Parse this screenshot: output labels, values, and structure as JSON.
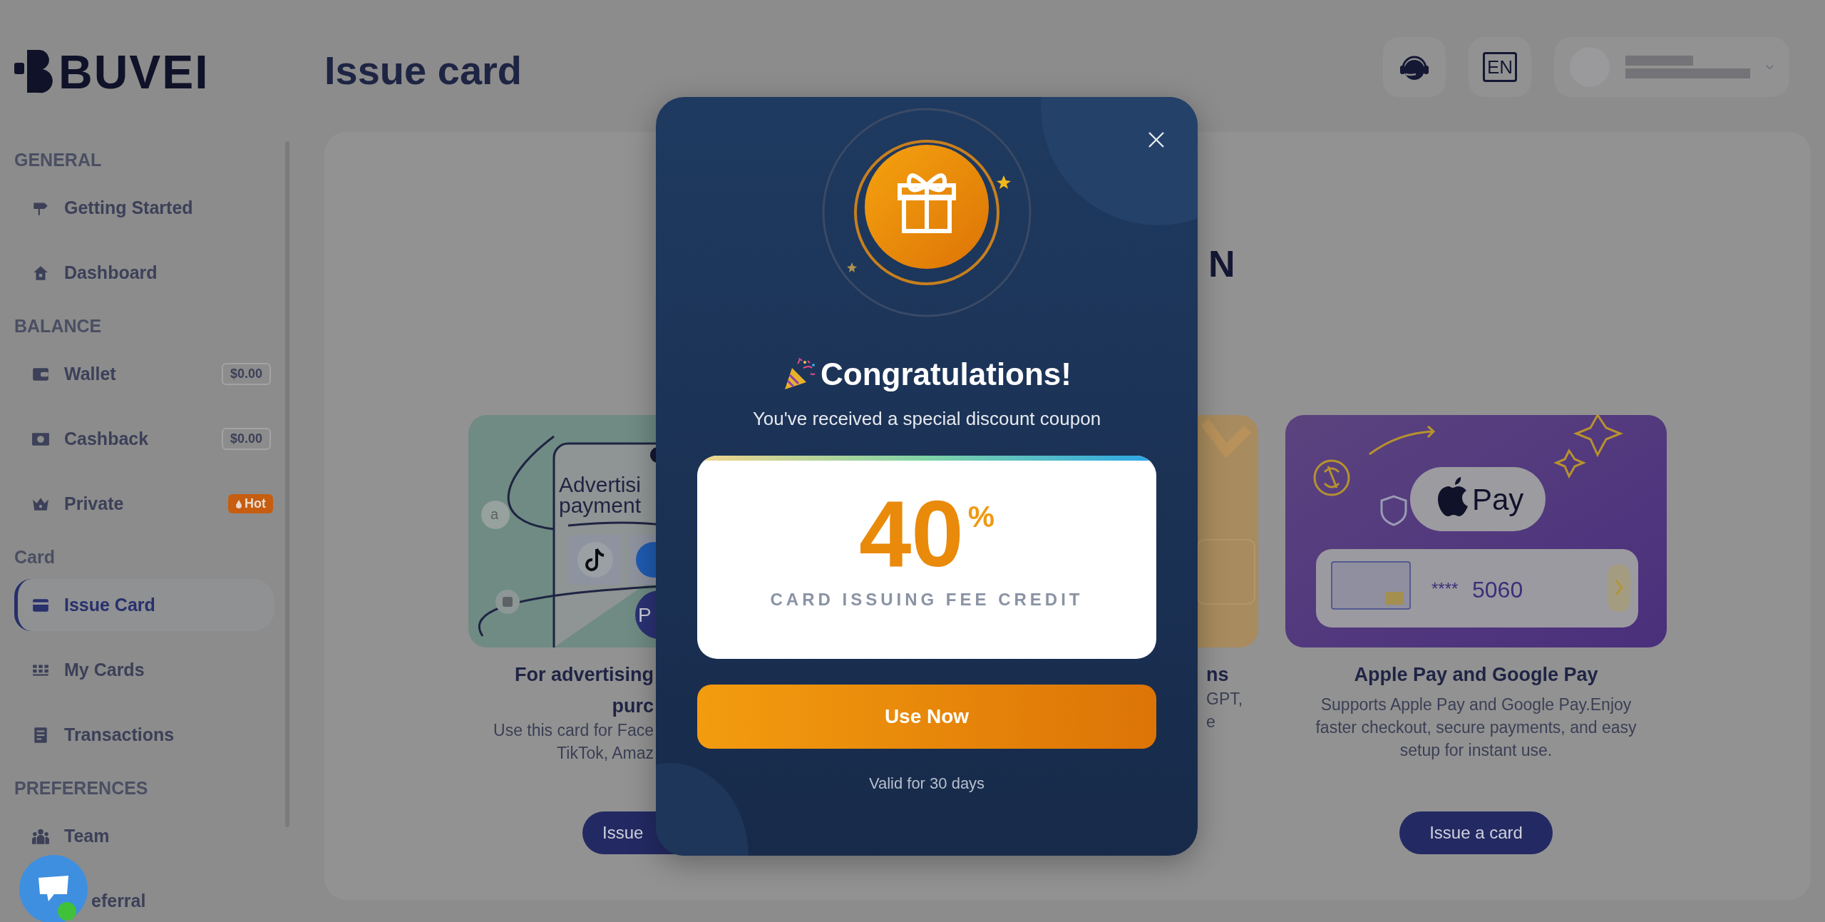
{
  "logo": {
    "text": "BUVEI"
  },
  "sidebar": {
    "sections": [
      {
        "title": "GENERAL",
        "items": [
          {
            "label": "Getting Started",
            "selected": false
          },
          {
            "label": "Dashboard",
            "selected": false
          }
        ]
      },
      {
        "title": "BALANCE",
        "items": [
          {
            "label": "Wallet",
            "selected": false,
            "badge": {
              "kind": "amount",
              "text": "$0.00"
            }
          },
          {
            "label": "Cashback",
            "selected": false,
            "badge": {
              "kind": "amount",
              "text": "$0.00"
            }
          },
          {
            "label": "Private",
            "selected": false,
            "badge": {
              "kind": "hot",
              "text": "Hot"
            }
          }
        ]
      },
      {
        "title": "Card",
        "items": [
          {
            "label": "Issue Card",
            "selected": true
          },
          {
            "label": "My Cards",
            "selected": false
          },
          {
            "label": "Transactions",
            "selected": false
          }
        ]
      },
      {
        "title": "PREFERENCES",
        "items": [
          {
            "label": "Team",
            "selected": false
          },
          {
            "label": "eferral",
            "selected": false
          }
        ]
      }
    ]
  },
  "header": {
    "title": "Issue card",
    "language": "EN"
  },
  "main": {
    "heading": "N",
    "cards": [
      {
        "kind": "ads",
        "image_texts": [
          "Advertisi",
          "payment"
        ],
        "amazon_letter": "a",
        "pay_letter": "P",
        "title_lines": [
          "For advertising",
          "purc"
        ],
        "description_lines": [
          "Use this card for Face",
          "TikTok, Amaz"
        ],
        "button": "Issue"
      },
      {
        "kind": "ai",
        "title_lines": [
          "ns"
        ],
        "description_lines": [
          "GPT,",
          "e"
        ]
      },
      {
        "kind": "wallet",
        "pay_label": "Pay",
        "card_mask": "****",
        "card_digits": "5060",
        "title_lines": [
          "Apple Pay and Google Pay"
        ],
        "description_lines": [
          "Supports Apple Pay and Google Pay.Enjoy",
          "faster checkout, secure payments, and easy",
          "setup for instant use."
        ],
        "button": "Issue a card"
      }
    ]
  },
  "modal": {
    "title": "Congratulations!",
    "subtitle": "You've received a special discount coupon",
    "coupon": {
      "value": "40",
      "unit": "%",
      "caption": "CARD ISSUING FEE CREDIT"
    },
    "button": "Use Now",
    "validity": "Valid for 30 days"
  }
}
